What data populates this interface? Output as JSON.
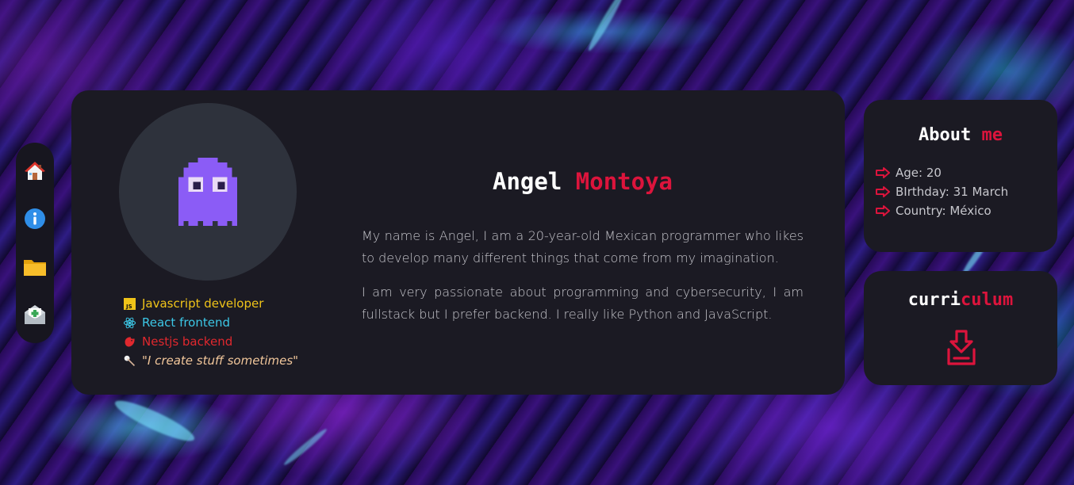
{
  "sidebar": {
    "items": [
      {
        "icon": "house-icon"
      },
      {
        "icon": "info-icon"
      },
      {
        "icon": "folder-icon"
      },
      {
        "icon": "mail-icon"
      }
    ]
  },
  "profile": {
    "first_name": "Angel",
    "last_name": "Montoya",
    "bio": [
      "My name is Angel, I am a 20-year-old Mexican programmer who likes to develop many different things that come from my imagination.",
      "I am very passionate about programming and cybersecurity, I am fullstack but I prefer backend. I really like Python and JavaScript."
    ],
    "skills": [
      {
        "label": "Javascript developer",
        "icon": "javascript-icon",
        "color": "#f0c419"
      },
      {
        "label": "React frontend",
        "icon": "react-icon",
        "color": "#3cc7e6"
      },
      {
        "label": "Nestjs backend",
        "icon": "nestjs-icon",
        "color": "#e0282e"
      },
      {
        "label": "\"I create stuff sometimes\"",
        "icon": "pushpin-icon",
        "color": "#f2c79b"
      }
    ]
  },
  "about": {
    "title_part1": "About",
    "title_part2": "me",
    "items": [
      "Age: 20",
      "BIrthday: 31 March",
      "Country: México"
    ]
  },
  "curriculum": {
    "title_part1": "curri",
    "title_part2": "culum"
  },
  "colors": {
    "accent": "#dc143c",
    "card_bg": "#1b1a23",
    "ghost": "#8b5cf6"
  }
}
